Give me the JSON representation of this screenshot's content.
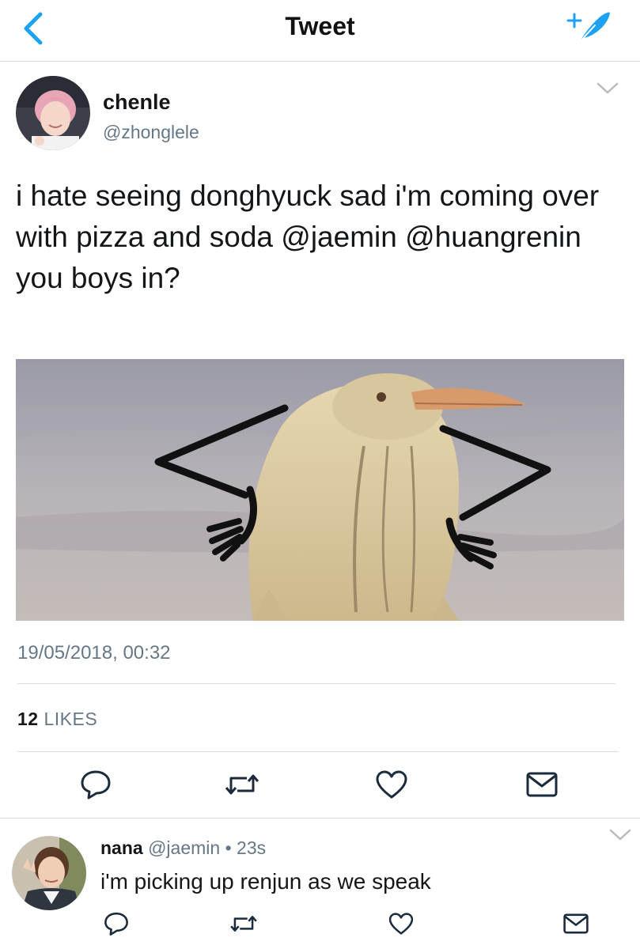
{
  "navbar": {
    "title": "Tweet",
    "back_icon": "chevron-left-icon",
    "compose_icon": "compose-feather-icon",
    "accent_color": "#1da1f2"
  },
  "tweet": {
    "author_name": "chenle",
    "author_handle": "@zhonglele",
    "text": "i hate seeing donghyuck sad i'm coming over with pizza and soda @jaemin @huangrenin you boys in?",
    "timestamp": "19/05/2018, 00:32",
    "likes_count": "12",
    "likes_label": "LIKES",
    "actions": [
      "reply-icon",
      "retweet-icon",
      "like-icon",
      "share-mail-icon"
    ]
  },
  "reply": {
    "author_name": "nana",
    "author_handle": "@jaemin",
    "separator": "•",
    "time_ago": "23s",
    "text": "i'm picking up renjun as we speak",
    "actions": [
      "reply-icon",
      "retweet-icon",
      "like-icon",
      "share-mail-icon"
    ]
  }
}
